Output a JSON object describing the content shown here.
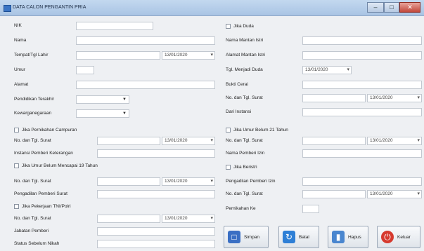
{
  "window": {
    "title": "DATA CALON PENGANTIN PRIA",
    "min": "–",
    "max": "□",
    "close": "✕"
  },
  "left": {
    "nik": "NIK",
    "nama": "Nama",
    "ttl": "Tempat/Tgl Lahir",
    "ttl_date": "13/01/2020",
    "umur": "Umur",
    "alamat": "Alamat",
    "pendidikan": "Pendidikan Terakhir",
    "kewarganegaraan": "Kewarganegaraan",
    "chk_campuran": "Jika Pernikahan Campuran",
    "no_surat1": "No. dan Tgl. Surat",
    "no_surat1_date": "13/01/2020",
    "instansi_keterangan": "Instansi Pemberi Keterangan",
    "chk_umur19": "Jika Umur Belum Mencapai 19 Tahun",
    "no_surat2": "No. dan Tgl. Surat",
    "no_surat2_date": "13/01/2020",
    "pengadilan": "Pengadilan Pemberi Surat",
    "chk_tni": "Jika Pekerjaan TNI/Polri",
    "no_surat3": "No. dan Tgl. Surat",
    "no_surat3_date": "13/01/2020",
    "jabatan": "Jabatan Pemberi",
    "status": "Status Sebelum Nikah"
  },
  "right": {
    "chk_duda": "Jika Duda",
    "nama_mantan": "Nama Mantan Istri",
    "alamat_mantan": "Alamat Mantan Istri",
    "tgl_duda": "Tgl. Menjadi Duda",
    "tgl_duda_date": "13/01/2020",
    "bukti_cerai": "Bukti Cerai",
    "no_surat_cerai": "No. dan Tgl. Surat",
    "no_surat_cerai_date": "13/01/2020",
    "dari_instansi": "Dari Instansi",
    "chk_umur21": "Jika Umur Belum 21 Tahun",
    "no_surat4": "No. dan Tgl. Surat",
    "no_surat4_date": "13/01/2020",
    "nama_pemberi_izin": "Nama Pemberi Izin",
    "chk_beristri": "Jika Beristri",
    "pengadilan_izin": "Pengadilan Pemberi Izin",
    "no_surat5": "No. dan Tgl. Surat",
    "no_surat5_date": "13/01/2020",
    "pernikahan_ke": "Pernikahan Ke"
  },
  "buttons": {
    "simpan": "Simpan",
    "batal": "Batal",
    "hapus": "Hapus",
    "keluar": "Keluar"
  },
  "date_dropdown": "▾",
  "combo_arrow": "▼",
  "colors": {
    "save": "#3a6fc4",
    "cancel": "#2e7fd6",
    "delete": "#4a86cf",
    "exit": "#d63a2f"
  }
}
